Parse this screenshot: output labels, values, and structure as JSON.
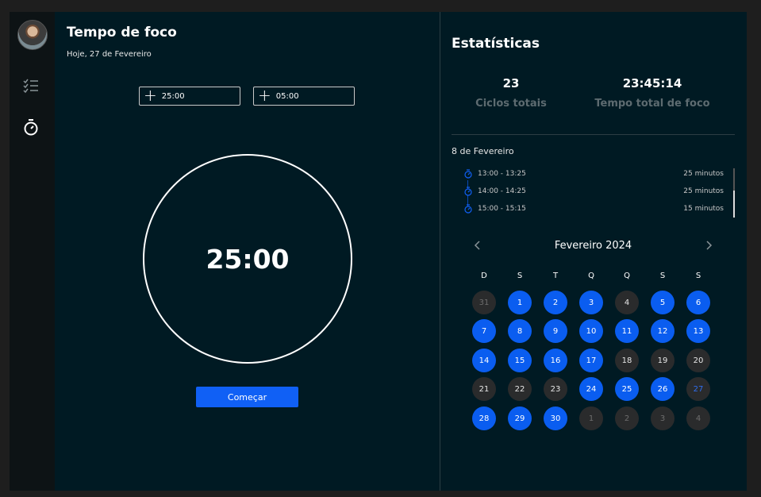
{
  "focus": {
    "title": "Tempo de foco",
    "date": "Hoje, 27 de Fevereiro",
    "focus_input": "25:00",
    "break_input": "05:00",
    "timer": "25:00",
    "start_label": "Começar"
  },
  "stats": {
    "title": "Estatísticas",
    "cycles_value": "23",
    "cycles_label": "Ciclos totais",
    "focus_total_value": "23:45:14",
    "focus_total_label": "Tempo total de foco",
    "session_date": "8 de Fevereiro",
    "sessions": [
      {
        "range": "13:00 - 13:25",
        "duration": "25 minutos"
      },
      {
        "range": "14:00 - 14:25",
        "duration": "25 minutos"
      },
      {
        "range": "15:00 - 15:15",
        "duration": "15 minutos"
      }
    ]
  },
  "calendar": {
    "month": "Fevereiro 2024",
    "weekdays": [
      "D",
      "S",
      "T",
      "Q",
      "Q",
      "S",
      "S"
    ],
    "weeks": [
      [
        {
          "d": "31",
          "s": "muted"
        },
        {
          "d": "1",
          "s": "active"
        },
        {
          "d": "2",
          "s": "active"
        },
        {
          "d": "3",
          "s": "active"
        },
        {
          "d": "4",
          "s": "inactive"
        },
        {
          "d": "5",
          "s": "active"
        },
        {
          "d": "6",
          "s": "active"
        }
      ],
      [
        {
          "d": "7",
          "s": "active"
        },
        {
          "d": "8",
          "s": "active"
        },
        {
          "d": "9",
          "s": "active"
        },
        {
          "d": "10",
          "s": "active"
        },
        {
          "d": "11",
          "s": "active"
        },
        {
          "d": "12",
          "s": "active"
        },
        {
          "d": "13",
          "s": "active"
        }
      ],
      [
        {
          "d": "14",
          "s": "active"
        },
        {
          "d": "15",
          "s": "active"
        },
        {
          "d": "16",
          "s": "active"
        },
        {
          "d": "17",
          "s": "active"
        },
        {
          "d": "18",
          "s": "inactive"
        },
        {
          "d": "19",
          "s": "inactive"
        },
        {
          "d": "20",
          "s": "inactive"
        }
      ],
      [
        {
          "d": "21",
          "s": "inactive"
        },
        {
          "d": "22",
          "s": "inactive"
        },
        {
          "d": "23",
          "s": "inactive"
        },
        {
          "d": "24",
          "s": "active"
        },
        {
          "d": "25",
          "s": "active"
        },
        {
          "d": "26",
          "s": "active"
        },
        {
          "d": "27",
          "s": "today-inactive"
        }
      ],
      [
        {
          "d": "28",
          "s": "active"
        },
        {
          "d": "29",
          "s": "active"
        },
        {
          "d": "30",
          "s": "active"
        },
        {
          "d": "1",
          "s": "muted"
        },
        {
          "d": "2",
          "s": "muted"
        },
        {
          "d": "3",
          "s": "muted"
        },
        {
          "d": "4",
          "s": "muted"
        }
      ]
    ]
  },
  "nav": {
    "icons": [
      "avatar",
      "checklist-icon",
      "stopwatch-icon"
    ]
  },
  "colors": {
    "accent": "#0a5df0",
    "panel": "#001a23",
    "sidebar": "#0d1315"
  }
}
